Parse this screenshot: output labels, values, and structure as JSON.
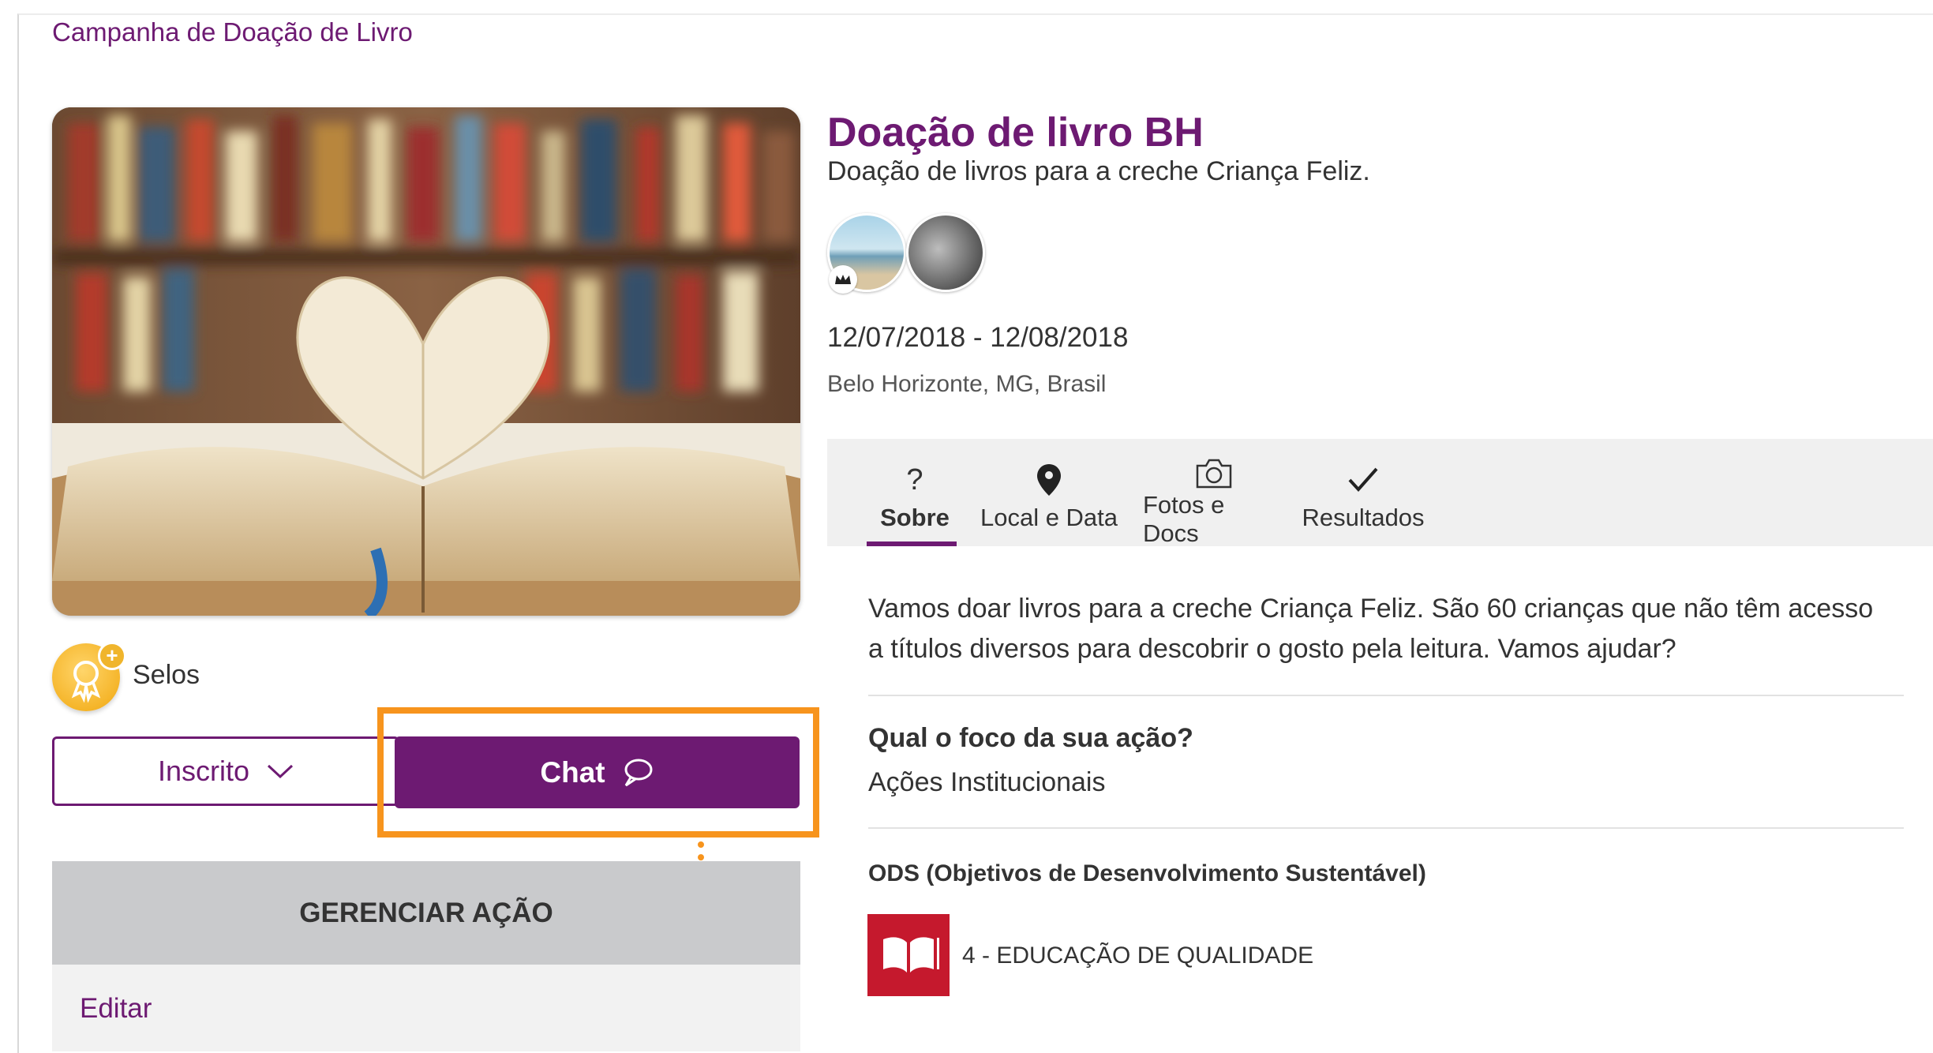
{
  "breadcrumb": "Campanha de Doação de Livro",
  "campaign": {
    "title": "Doação de livro BH",
    "subtitle": "Doação de livros para a creche Criança Feliz.",
    "dates": "12/07/2018 - 12/08/2018",
    "location": "Belo Horizonte, MG, Brasil"
  },
  "badges": {
    "label": "Selos"
  },
  "buttons": {
    "subscribed": "Inscrito",
    "chat": "Chat"
  },
  "manage": {
    "title": "GERENCIAR AÇÃO",
    "edit": "Editar"
  },
  "tabs": [
    {
      "icon": "question-icon",
      "glyph": "?",
      "label": "Sobre",
      "active": true
    },
    {
      "icon": "map-pin-icon",
      "label": "Local e Data",
      "active": false
    },
    {
      "icon": "camera-icon",
      "label": "Fotos e Docs",
      "active": false
    },
    {
      "icon": "check-icon",
      "label": "Resultados",
      "active": false
    }
  ],
  "about": {
    "description": "Vamos doar livros para a creche Criança Feliz. São 60 crianças que não têm acesso a títulos diversos para descobrir o gosto pela leitura. Vamos ajudar?",
    "focus_question": "Qual o foco da sua ação?",
    "focus_answer": "Ações Institucionais",
    "ods_title": "ODS (Objetivos de Desenvolvimento Sustentável)",
    "ods_item": "4 - EDUCAÇÃO DE QUALIDADE"
  },
  "colors": {
    "brand": "#6d1a72",
    "highlight": "#f7941d",
    "ods4": "#c5192d"
  }
}
